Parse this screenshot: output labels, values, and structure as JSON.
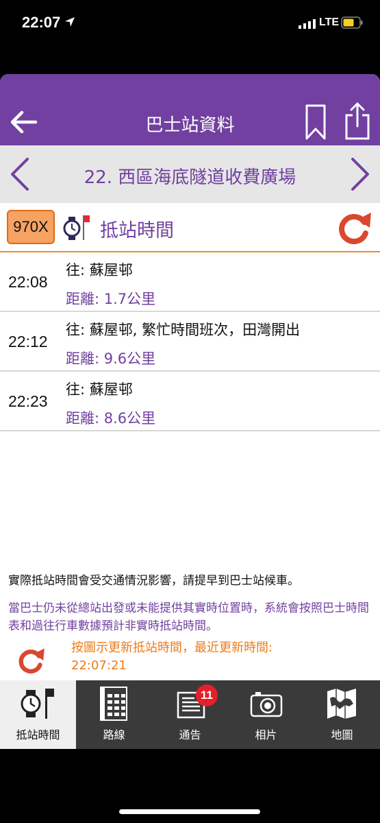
{
  "status": {
    "time": "22:07",
    "network": "LTE"
  },
  "header": {
    "title": "巴士站資料"
  },
  "stop": {
    "name": "22. 西區海底隧道收費廣場"
  },
  "eta": {
    "route": "970X",
    "label": "抵站時間",
    "rows": [
      {
        "time": "22:08",
        "dest": "往: 蘇屋邨",
        "distance": "距離: 1.7公里"
      },
      {
        "time": "22:12",
        "dest": "往: 蘇屋邨, 繁忙時間班次，田灣開出",
        "distance": "距離: 9.6公里"
      },
      {
        "time": "22:23",
        "dest": "往: 蘇屋邨",
        "distance": "距離: 8.6公里"
      }
    ]
  },
  "notes": {
    "traffic": "實際抵站時間會受交通情況影響，請提早到巴士站候車。",
    "schedule": "當巴士仍未從總站出發或未能提供其實時位置時，系統會按照巴士時間表和過往行車數據預計非實時抵站時間。",
    "update_line1": "按圖示更新抵站時間，最近更新時間:",
    "update_line2": "22:07:21"
  },
  "tabs": [
    {
      "label": "抵站時間",
      "icon": "watch-flag-icon",
      "active": true
    },
    {
      "label": "路線",
      "icon": "route-list-icon"
    },
    {
      "label": "通告",
      "icon": "notice-icon",
      "badge": "11"
    },
    {
      "label": "相片",
      "icon": "camera-icon"
    },
    {
      "label": "地圖",
      "icon": "map-icon"
    }
  ],
  "colors": {
    "brand": "#7140a0",
    "accent": "#f08a24",
    "refresh": "#d9482f",
    "badge": "#e5202a"
  }
}
